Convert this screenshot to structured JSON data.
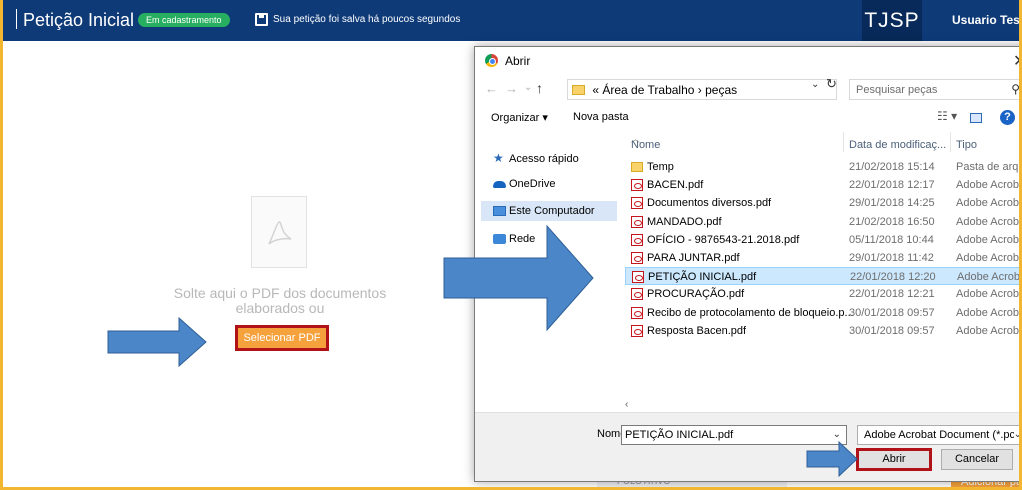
{
  "header": {
    "title": "Petição Inicial",
    "status_badge": "Em cadastramento",
    "save_status": "Sua petição foi salva há poucos segundos",
    "brand": "TJSP",
    "user": "Usuario Teste"
  },
  "dropzone": {
    "text": "Solte aqui o PDF dos documentos elaborados ou",
    "button": "Selecionar PDF"
  },
  "background": {
    "polo_label": "POLO ATIVO",
    "add_button": "Adicionar pa"
  },
  "dialog": {
    "title": "Abrir",
    "path": {
      "prefix": "«",
      "segments": [
        "Área de Trabalho",
        "peças"
      ],
      "separator": "›"
    },
    "search_placeholder": "Pesquisar peças",
    "toolbar": {
      "organize": "Organizar ▾",
      "new_folder": "Nova pasta"
    },
    "sidebar": [
      {
        "label": "Acesso rápido",
        "icon": "star-icon"
      },
      {
        "label": "OneDrive",
        "icon": "cloud-icon"
      },
      {
        "label": "Este Computador",
        "icon": "computer-icon",
        "active": true
      },
      {
        "label": "Rede",
        "icon": "network-icon"
      }
    ],
    "columns": [
      "Nome",
      "Data de modificaç...",
      "Tipo"
    ],
    "files": [
      {
        "name": "Temp",
        "date": "21/02/2018 15:14",
        "type": "Pasta de arquiv",
        "kind": "folder"
      },
      {
        "name": "BACEN.pdf",
        "date": "22/01/2018 12:17",
        "type": "Adobe Acrobat",
        "kind": "pdf"
      },
      {
        "name": "Documentos diversos.pdf",
        "date": "29/01/2018 14:25",
        "type": "Adobe Acrobat",
        "kind": "pdf"
      },
      {
        "name": "MANDADO.pdf",
        "date": "21/02/2018 16:50",
        "type": "Adobe Acrobat",
        "kind": "pdf"
      },
      {
        "name": "OFÍCIO - 9876543-21.2018.pdf",
        "date": "05/11/2018 10:44",
        "type": "Adobe Acrobat",
        "kind": "pdf"
      },
      {
        "name": "PARA JUNTAR.pdf",
        "date": "29/01/2018 11:42",
        "type": "Adobe Acrobat",
        "kind": "pdf"
      },
      {
        "name": "PETIÇÃO INICIAL.pdf",
        "date": "22/01/2018 12:20",
        "type": "Adobe Acrobat",
        "kind": "pdf",
        "selected": true
      },
      {
        "name": "PROCURAÇÃO.pdf",
        "date": "22/01/2018 12:21",
        "type": "Adobe Acrobat",
        "kind": "pdf"
      },
      {
        "name": "Recibo de protocolamento de bloqueio.p...",
        "date": "30/01/2018 09:57",
        "type": "Adobe Acrobat",
        "kind": "pdf"
      },
      {
        "name": "Resposta Bacen.pdf",
        "date": "30/01/2018 09:57",
        "type": "Adobe Acrobat",
        "kind": "pdf"
      }
    ],
    "filename_label": "Nome:",
    "filename_value": "PETIÇÃO INICIAL.pdf",
    "filetype": "Adobe Acrobat Document (*.pc",
    "open_button": "Abrir",
    "cancel_button": "Cancelar"
  },
  "colors": {
    "header_bg": "#0e3a78",
    "badge": "#27ae60",
    "accent_orange": "#f5a13c",
    "highlight_red": "#b01218",
    "arrow_blue": "#4a86c8",
    "frame_yellow": "#f2b630",
    "selection": "#cce8ff"
  }
}
